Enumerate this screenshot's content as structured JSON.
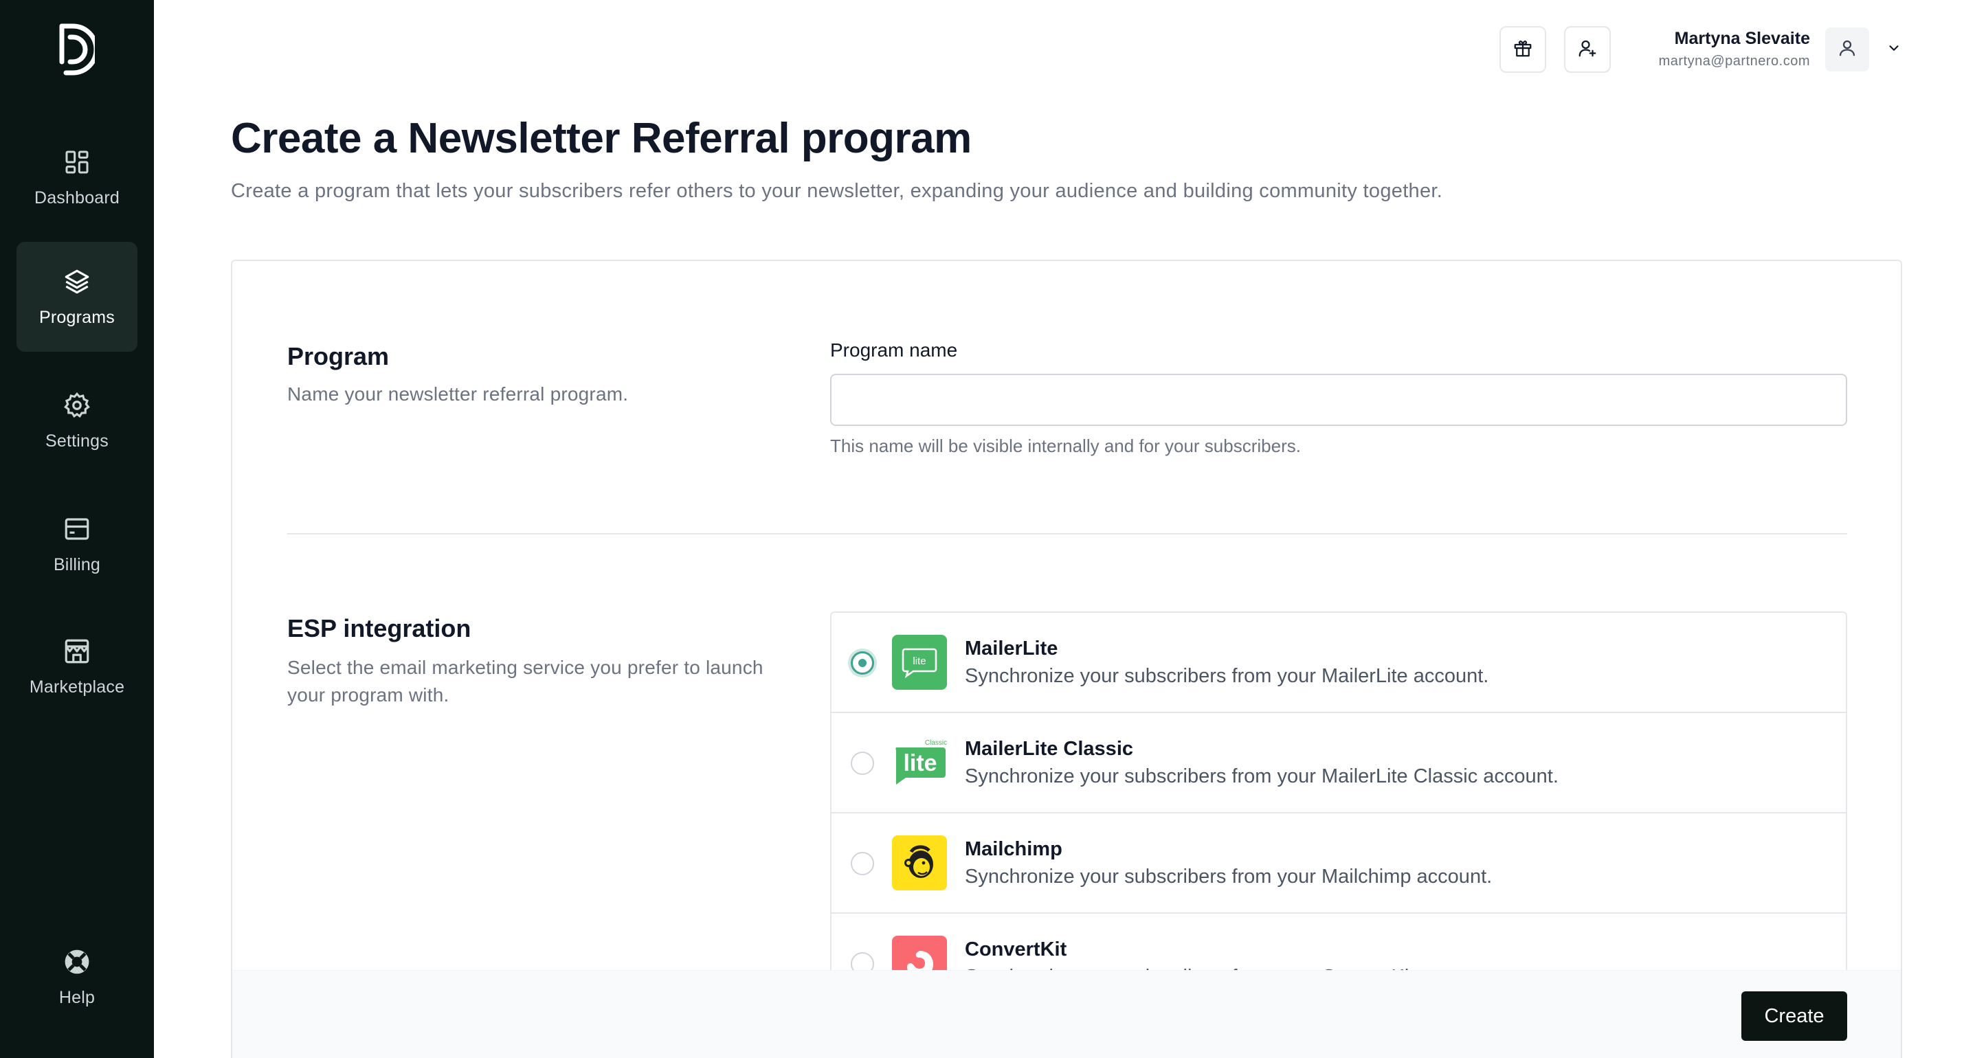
{
  "sidebar": {
    "items": [
      {
        "label": "Dashboard",
        "icon": "dashboard-icon"
      },
      {
        "label": "Programs",
        "icon": "layers-icon",
        "active": true
      },
      {
        "label": "Settings",
        "icon": "gear-icon"
      },
      {
        "label": "Billing",
        "icon": "billing-icon"
      },
      {
        "label": "Marketplace",
        "icon": "store-icon"
      }
    ],
    "help": {
      "label": "Help",
      "icon": "lifebuoy-icon"
    }
  },
  "header": {
    "user_name": "Martyna Slevaite",
    "user_email": "martyna@partnero.com",
    "icons": [
      "gift-icon",
      "add-user-icon",
      "user-icon",
      "chevron-down-icon"
    ]
  },
  "page": {
    "title": "Create a Newsletter Referral program",
    "subtitle": "Create a program that lets your subscribers refer others to your newsletter, expanding your audience and building community together."
  },
  "program_section": {
    "title": "Program",
    "description": "Name your newsletter referral program.",
    "field_label": "Program name",
    "field_value": "",
    "field_hint": "This name will be visible internally and for your subscribers."
  },
  "esp_section": {
    "title": "ESP integration",
    "description": "Select the email marketing service you prefer to launch your program with.",
    "options": [
      {
        "name": "MailerLite",
        "description": "Synchronize your subscribers from your MailerLite account.",
        "selected": true,
        "logo_text": "lite",
        "logo_color": "#48b866"
      },
      {
        "name": "MailerLite Classic",
        "description": "Synchronize your subscribers from your MailerLite Classic account.",
        "selected": false,
        "logo_text": "lite",
        "logo_badge": "Classic",
        "logo_color": "#48b866"
      },
      {
        "name": "Mailchimp",
        "description": "Synchronize your subscribers from your Mailchimp account.",
        "selected": false,
        "logo_color": "#ffe01b"
      },
      {
        "name": "ConvertKit",
        "description": "Synchronize your subscribers from your ConvertKit account.",
        "selected": false,
        "logo_color": "#fb6970"
      }
    ]
  },
  "footer": {
    "create_label": "Create"
  },
  "colors": {
    "sidebar_bg": "#0a1614",
    "sidebar_active": "#1b2a27",
    "accent": "#3fa392",
    "primary_button": "#0d1513"
  }
}
